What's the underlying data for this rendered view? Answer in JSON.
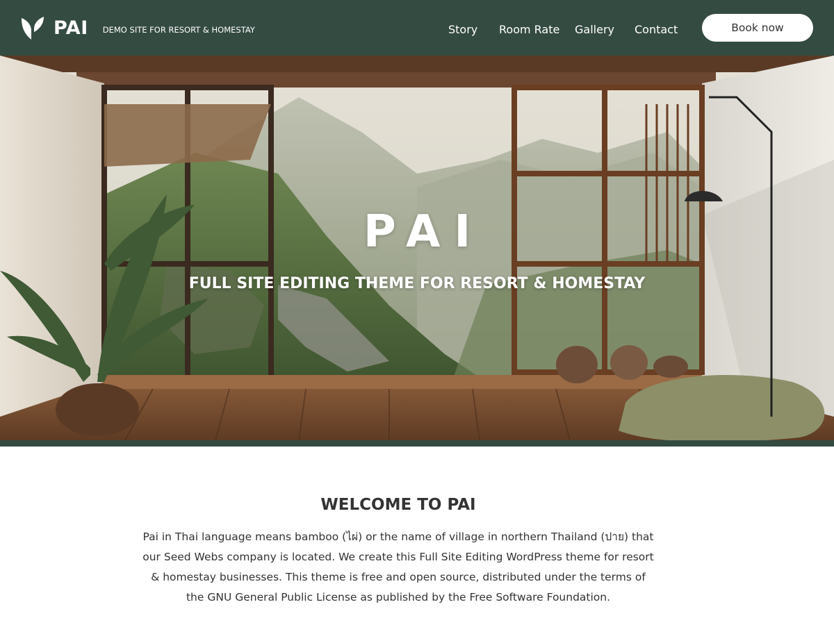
{
  "header": {
    "brand_name": "PAI",
    "tagline": "DEMO SITE FOR RESORT & HOMESTAY",
    "nav": [
      {
        "label": "Story"
      },
      {
        "label": "Room Rate"
      },
      {
        "label": "Gallery"
      },
      {
        "label": "Contact"
      }
    ],
    "cta_label": "Book now",
    "logo_icon": "bamboo-leaf-logo"
  },
  "hero": {
    "title": "PAI",
    "subtitle": "FULL SITE EDITING THEME FOR RESORT & HOMESTAY"
  },
  "welcome": {
    "title": "WELCOME TO PAI",
    "body": "Pai in Thai language means bamboo (ไผ่) or the name of village in northern Thailand (ปาย) that our Seed Webs company is located. We create this Full Site Editing WordPress theme for resort & homestay businesses. This theme is free and open source, distributed under the terms of the GNU General Public License as published by the Free Software Foundation."
  },
  "colors": {
    "header_bg": "#344b42",
    "text_dark": "#333333",
    "button_bg": "#ffffff"
  }
}
